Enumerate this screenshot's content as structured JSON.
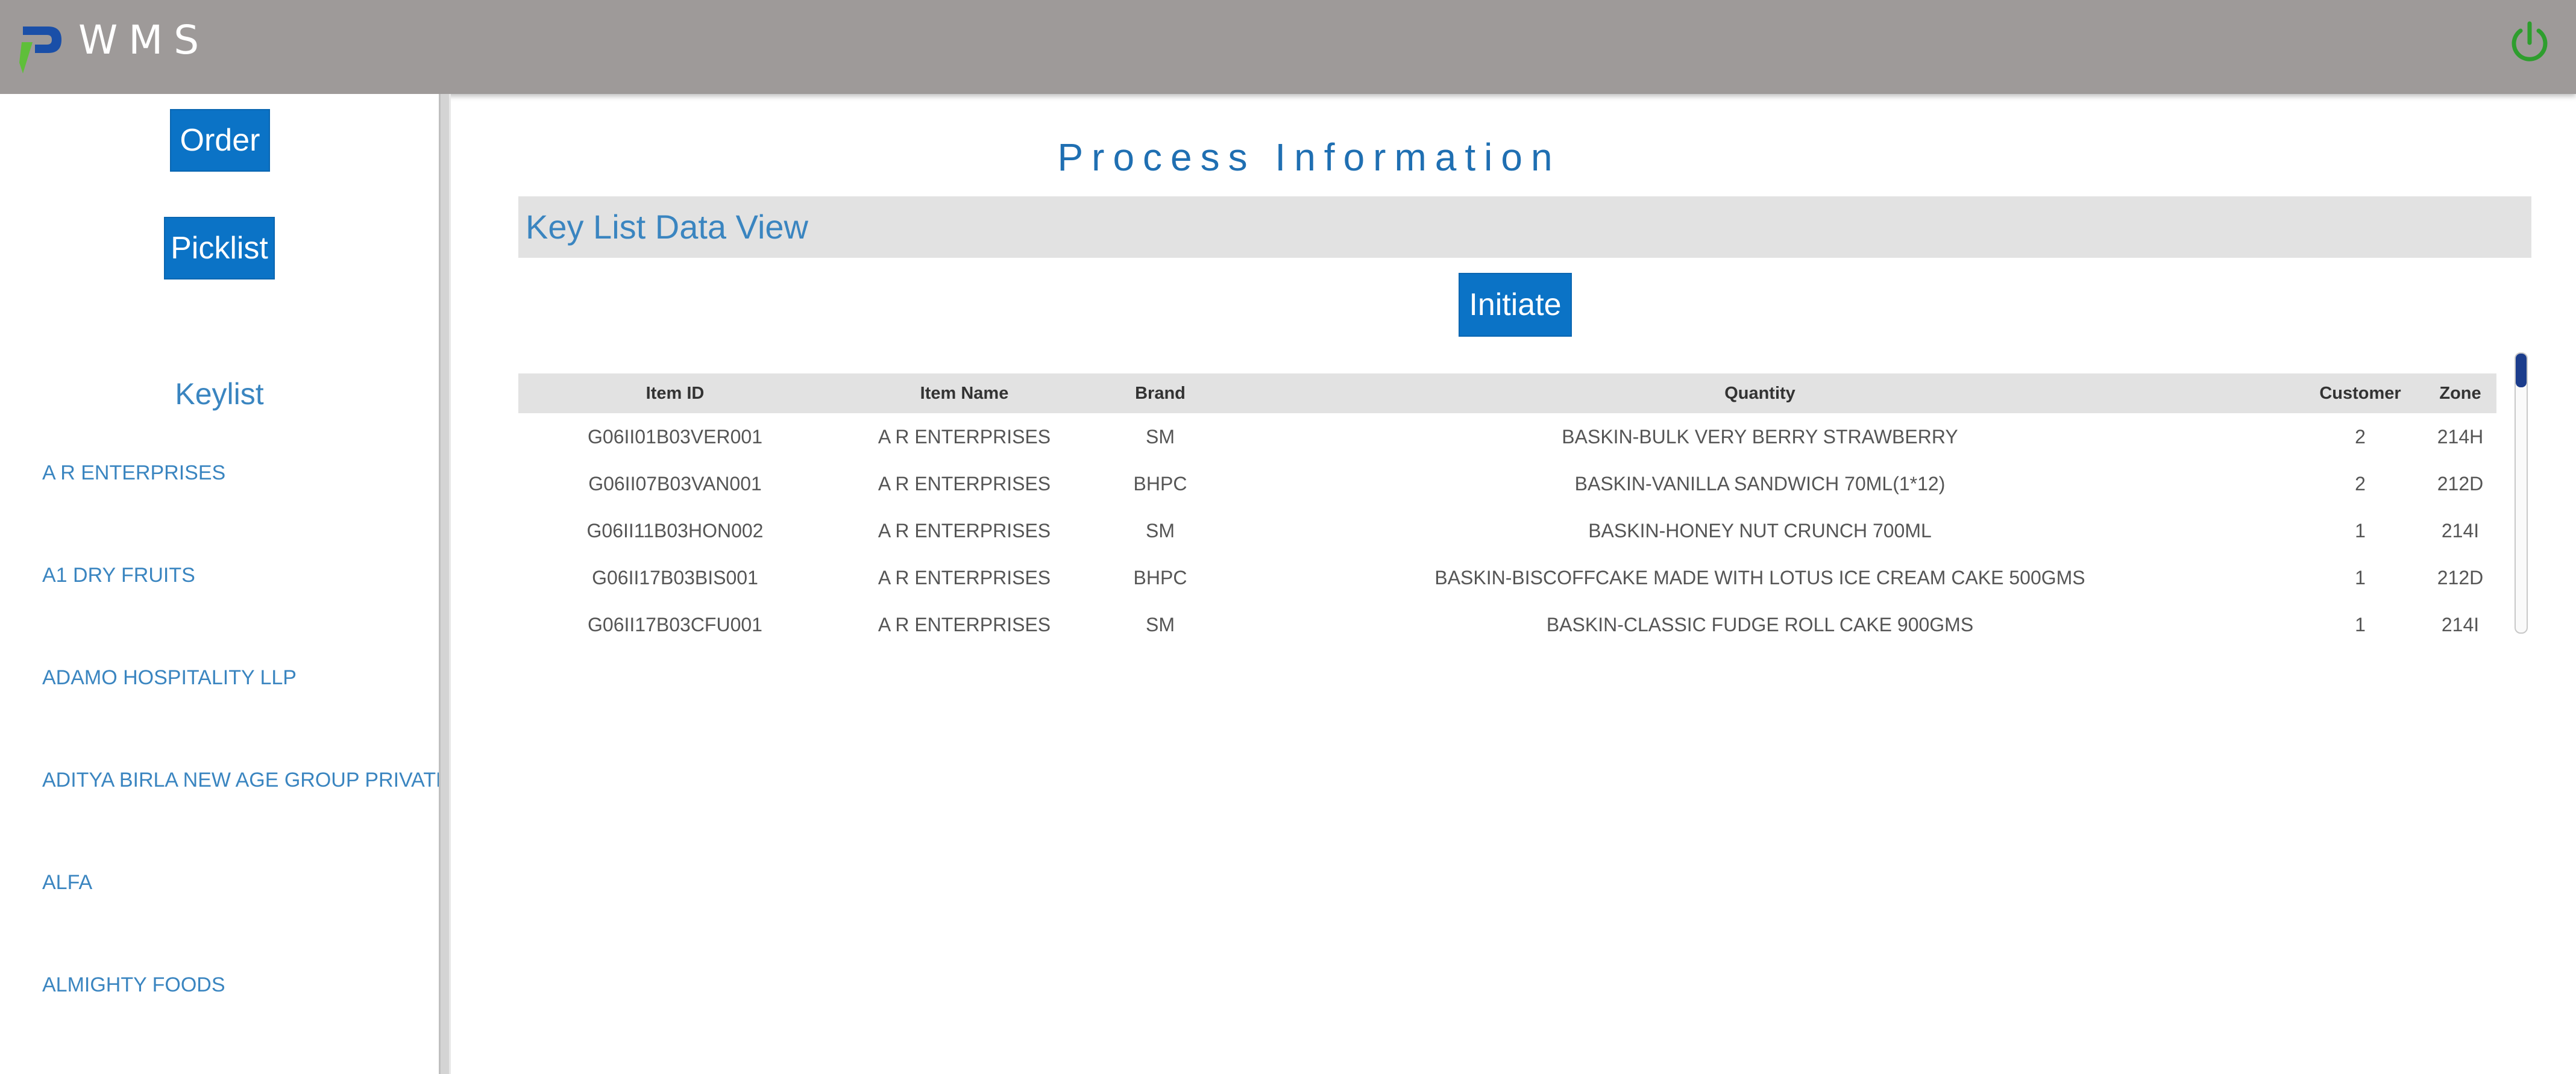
{
  "header": {
    "app_title": "WMS",
    "brand_colors": {
      "logo_blue": "#1a4fa8",
      "logo_green": "#5fbf3a",
      "power": "#2e9e2e"
    }
  },
  "sidebar": {
    "order_label": "Order",
    "picklist_label": "Picklist",
    "keylist_title": "Keylist",
    "items": [
      {
        "label": "A R ENTERPRISES"
      },
      {
        "label": "A1 DRY FRUITS"
      },
      {
        "label": "ADAMO HOSPITALITY LLP"
      },
      {
        "label": "ADITYA BIRLA NEW AGE GROUP PRIVATE LIMITED"
      },
      {
        "label": "ALFA"
      },
      {
        "label": "ALMIGHTY FOODS"
      }
    ]
  },
  "main": {
    "page_title": "Process Information",
    "section_title": "Key List Data View",
    "initiate_label": "Initiate",
    "table": {
      "columns": [
        "Item ID",
        "Item Name",
        "Brand",
        "Quantity",
        "Customer",
        "Zone"
      ],
      "rows": [
        [
          "G06II01B03VER001",
          "A R ENTERPRISES",
          "SM",
          "BASKIN-BULK VERY BERRY STRAWBERRY",
          "2",
          "214H"
        ],
        [
          "G06II07B03VAN001",
          "A R ENTERPRISES",
          "BHPC",
          "BASKIN-VANILLA SANDWICH 70ML(1*12)",
          "2",
          "212D"
        ],
        [
          "G06II11B03HON002",
          "A R ENTERPRISES",
          "SM",
          "BASKIN-HONEY NUT CRUNCH 700ML",
          "1",
          "214I"
        ],
        [
          "G06II17B03BIS001",
          "A R ENTERPRISES",
          "BHPC",
          "BASKIN-BISCOFFCAKE MADE WITH LOTUS ICE CREAM CAKE 500GMS",
          "1",
          "212D"
        ],
        [
          "G06II17B03CFU001",
          "A R ENTERPRISES",
          "SM",
          "BASKIN-CLASSIC FUDGE ROLL CAKE 900GMS",
          "1",
          "214I"
        ]
      ]
    }
  }
}
